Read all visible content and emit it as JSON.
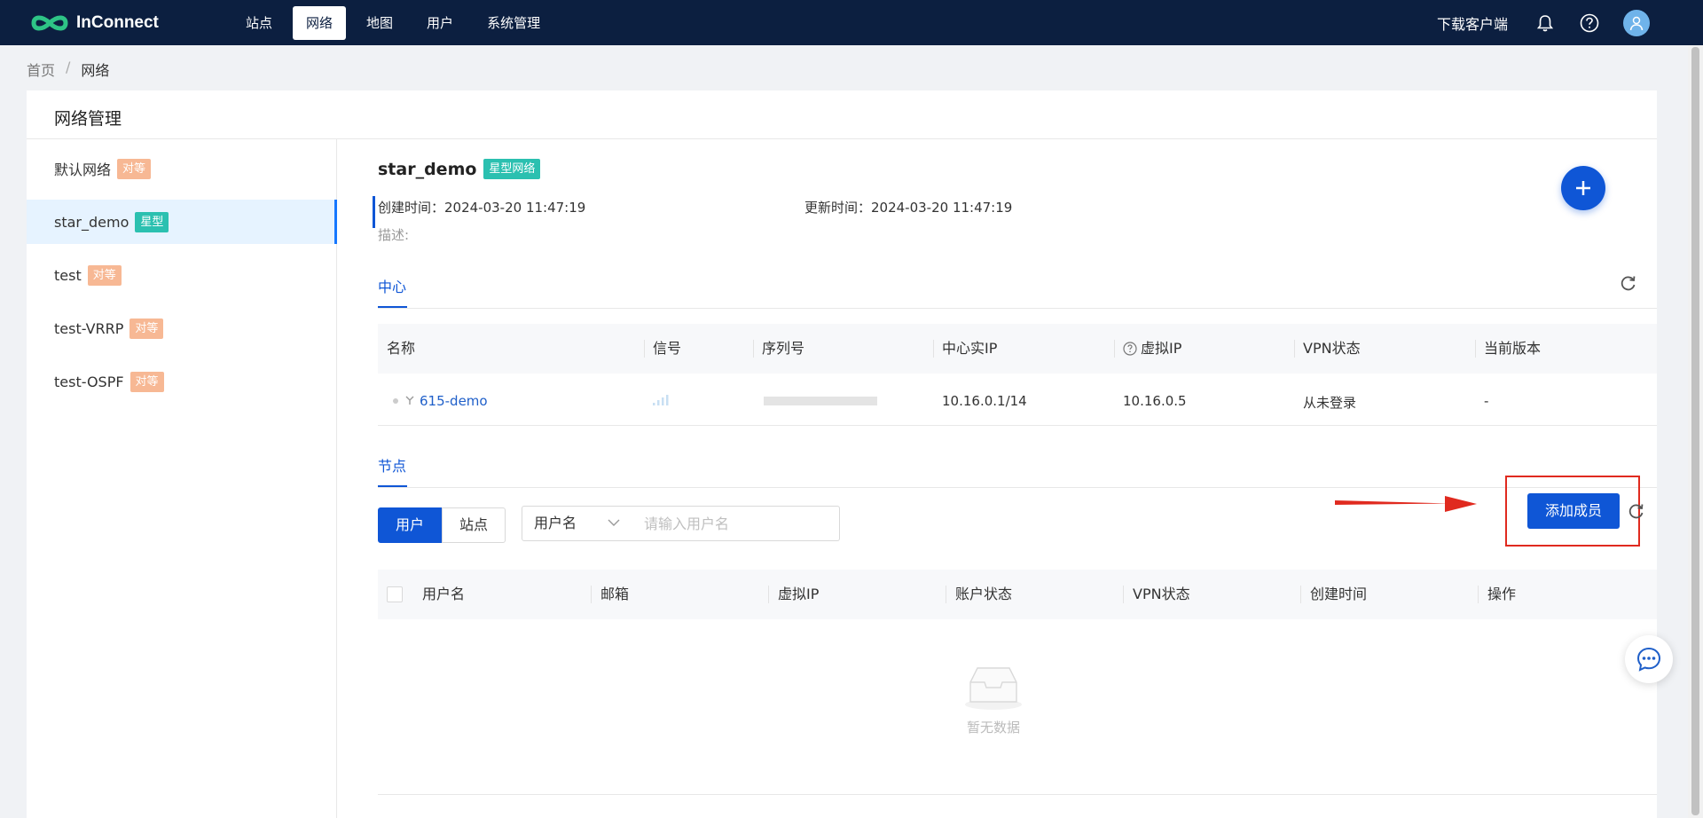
{
  "brand": {
    "name": "InConnect"
  },
  "nav": {
    "items": [
      {
        "label": "站点",
        "active": false
      },
      {
        "label": "网络",
        "active": true
      },
      {
        "label": "地图",
        "active": false
      },
      {
        "label": "用户",
        "active": false
      },
      {
        "label": "系统管理",
        "active": false
      }
    ],
    "download_label": "下载客户端"
  },
  "breadcrumb": {
    "home": "首页",
    "sep": "/",
    "current": "网络"
  },
  "panel": {
    "title": "网络管理"
  },
  "sidebar": {
    "items": [
      {
        "name": "默认网络",
        "tag": "对等",
        "active": false
      },
      {
        "name": "star_demo",
        "tag": "星型",
        "active": true
      },
      {
        "name": "test",
        "tag": "对等",
        "active": false
      },
      {
        "name": "test-VRRP",
        "tag": "对等",
        "active": false
      },
      {
        "name": "test-OSPF",
        "tag": "对等",
        "active": false
      }
    ]
  },
  "network": {
    "name": "star_demo",
    "type_tag": "星型网络",
    "created": "创建时间：2024-03-20 11:47:19",
    "updated": "更新时间：2024-03-20 11:47:19",
    "description": "描述:"
  },
  "center": {
    "tab_label": "中心",
    "columns": [
      "名称",
      "信号",
      "序列号",
      "中心实IP",
      "虚拟IP",
      "VPN状态",
      "当前版本"
    ],
    "rows": [
      {
        "name": "615-demo",
        "serial": "",
        "real_ip": "10.16.0.1/14",
        "virtual_ip": "10.16.0.5",
        "vpn_status": "从未登录",
        "version": "-"
      }
    ]
  },
  "nodes": {
    "tab_label": "节点",
    "add_member_label": "添加成员",
    "segments": [
      "用户",
      "站点"
    ],
    "filter_select": "用户名",
    "search_placeholder": "请输入用户名",
    "columns": [
      "用户名",
      "邮箱",
      "虚拟IP",
      "账户状态",
      "VPN状态",
      "创建时间",
      "操作"
    ],
    "empty_text": "暂无数据"
  },
  "colors": {
    "topbar": "#0c1f40",
    "primary": "#0f56d6",
    "peer_tag": "#f7b894",
    "star_tag": "#2bc0b0",
    "annotation": "#e02a1f"
  }
}
